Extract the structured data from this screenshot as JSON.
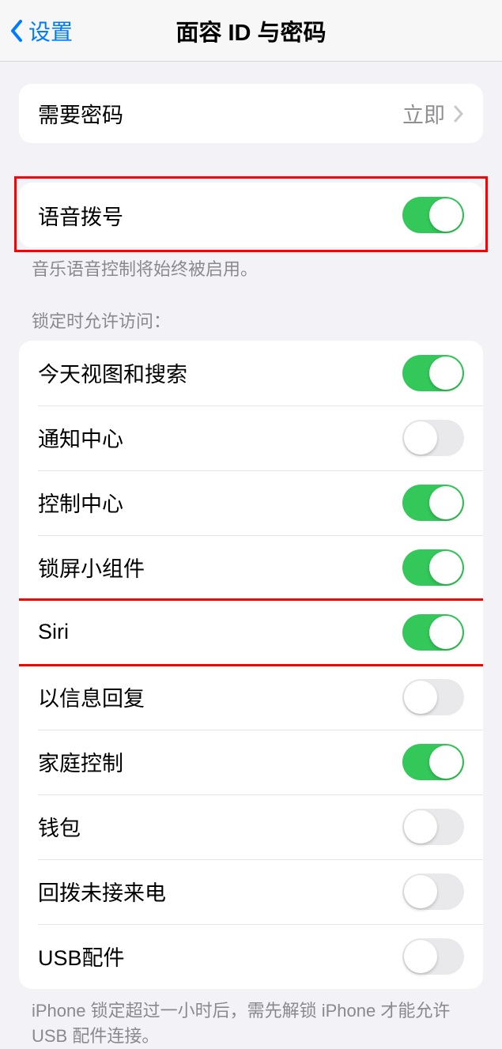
{
  "nav": {
    "back_label": "设置",
    "title": "面容 ID 与密码"
  },
  "passcode_section": {
    "require_passcode_label": "需要密码",
    "require_passcode_value": "立即"
  },
  "voice_dial": {
    "label": "语音拨号",
    "enabled": true,
    "footer": "音乐语音控制将始终被启用。"
  },
  "lock_access": {
    "header": "锁定时允许访问：",
    "items": [
      {
        "label": "今天视图和搜索",
        "enabled": true
      },
      {
        "label": "通知中心",
        "enabled": false
      },
      {
        "label": "控制中心",
        "enabled": true
      },
      {
        "label": "锁屏小组件",
        "enabled": true
      },
      {
        "label": "Siri",
        "enabled": true
      },
      {
        "label": "以信息回复",
        "enabled": false
      },
      {
        "label": "家庭控制",
        "enabled": true
      },
      {
        "label": "钱包",
        "enabled": false
      },
      {
        "label": "回拨未接来电",
        "enabled": false
      },
      {
        "label": "USB配件",
        "enabled": false
      }
    ],
    "footer": "iPhone 锁定超过一小时后，需先解锁 iPhone 才能允许 USB 配件连接。"
  }
}
